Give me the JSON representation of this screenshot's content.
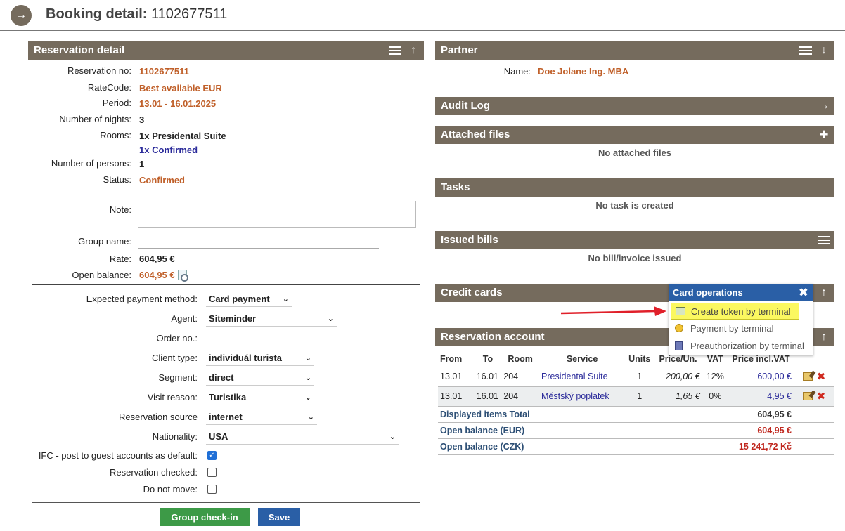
{
  "header": {
    "title_label": "Booking detail:",
    "booking_no": "1102677511"
  },
  "reservation_detail": {
    "title": "Reservation detail",
    "fields": {
      "reservation_no_label": "Reservation no:",
      "reservation_no": "1102677511",
      "ratecode_label": "RateCode:",
      "ratecode": "Best available EUR",
      "period_label": "Period:",
      "period": "13.01 - 16.01.2025",
      "nights_label": "Number of nights:",
      "nights": "3",
      "rooms_label": "Rooms:",
      "rooms": "1x Presidental Suite",
      "rooms_status": "1x Confirmed",
      "persons_label": "Number of persons:",
      "persons": "1",
      "status_label": "Status:",
      "status": "Confirmed",
      "note_label": "Note:",
      "group_name_label": "Group name:",
      "rate_label": "Rate:",
      "rate": "604,95 €",
      "open_balance_label": "Open balance:",
      "open_balance": "604,95 €"
    },
    "form": {
      "payment_label": "Expected payment method:",
      "payment": "Card payment",
      "agent_label": "Agent:",
      "agent": "Siteminder",
      "order_label": "Order no.:",
      "client_label": "Client type:",
      "client": "individuál turista",
      "segment_label": "Segment:",
      "segment": "direct",
      "visit_label": "Visit reason:",
      "visit": "Turistika",
      "source_label": "Reservation source",
      "source": "internet",
      "nationality_label": "Nationality:",
      "nationality": "USA",
      "ifc_label": "IFC - post to guest accounts as default:",
      "ifc_checked": true,
      "checked_label": "Reservation checked:",
      "checked": false,
      "donotmove_label": "Do not move:",
      "donotmove": false
    },
    "buttons": {
      "group_checkin": "Group check-in",
      "save": "Save"
    }
  },
  "partner": {
    "title": "Partner",
    "name_label": "Name:",
    "name": "Doe Jolane Ing. MBA"
  },
  "audit_log": {
    "title": "Audit Log"
  },
  "attached_files": {
    "title": "Attached files",
    "empty": "No attached files"
  },
  "tasks": {
    "title": "Tasks",
    "empty": "No task is created"
  },
  "issued_bills": {
    "title": "Issued bills",
    "empty": "No bill/invoice issued"
  },
  "credit_cards": {
    "title": "Credit cards"
  },
  "card_operations": {
    "title": "Card operations",
    "items": [
      "Create token by terminal",
      "Payment by terminal",
      "Preauthorization by terminal"
    ]
  },
  "reservation_account": {
    "title": "Reservation account",
    "columns": [
      "From",
      "To",
      "Room",
      "Service",
      "Units",
      "Price/Un.",
      "VAT",
      "Price incl.VAT"
    ],
    "rows": [
      {
        "from": "13.01",
        "to": "16.01",
        "room": "204",
        "service": "Presidental Suite",
        "units": "1",
        "price_un": "200,00 €",
        "vat": "12%",
        "price_incl": "600,00 €"
      },
      {
        "from": "13.01",
        "to": "16.01",
        "room": "204",
        "service": "Městský poplatek",
        "units": "1",
        "price_un": "1,65 €",
        "vat": "0%",
        "price_incl": "4,95 €"
      }
    ],
    "totals": {
      "displayed_label": "Displayed items Total",
      "displayed": "604,95 €",
      "open_eur_label": "Open balance (EUR)",
      "open_eur": "604,95 €",
      "open_czk_label": "Open balance (CZK)",
      "open_czk": "15 241,72 Kč"
    }
  },
  "colors": {
    "panel_header": "#756b5d",
    "accent_orange": "#c0602a",
    "link_blue": "#2a2a9a",
    "popup_blue": "#2a5fa6",
    "highlight": "#fbf860"
  }
}
